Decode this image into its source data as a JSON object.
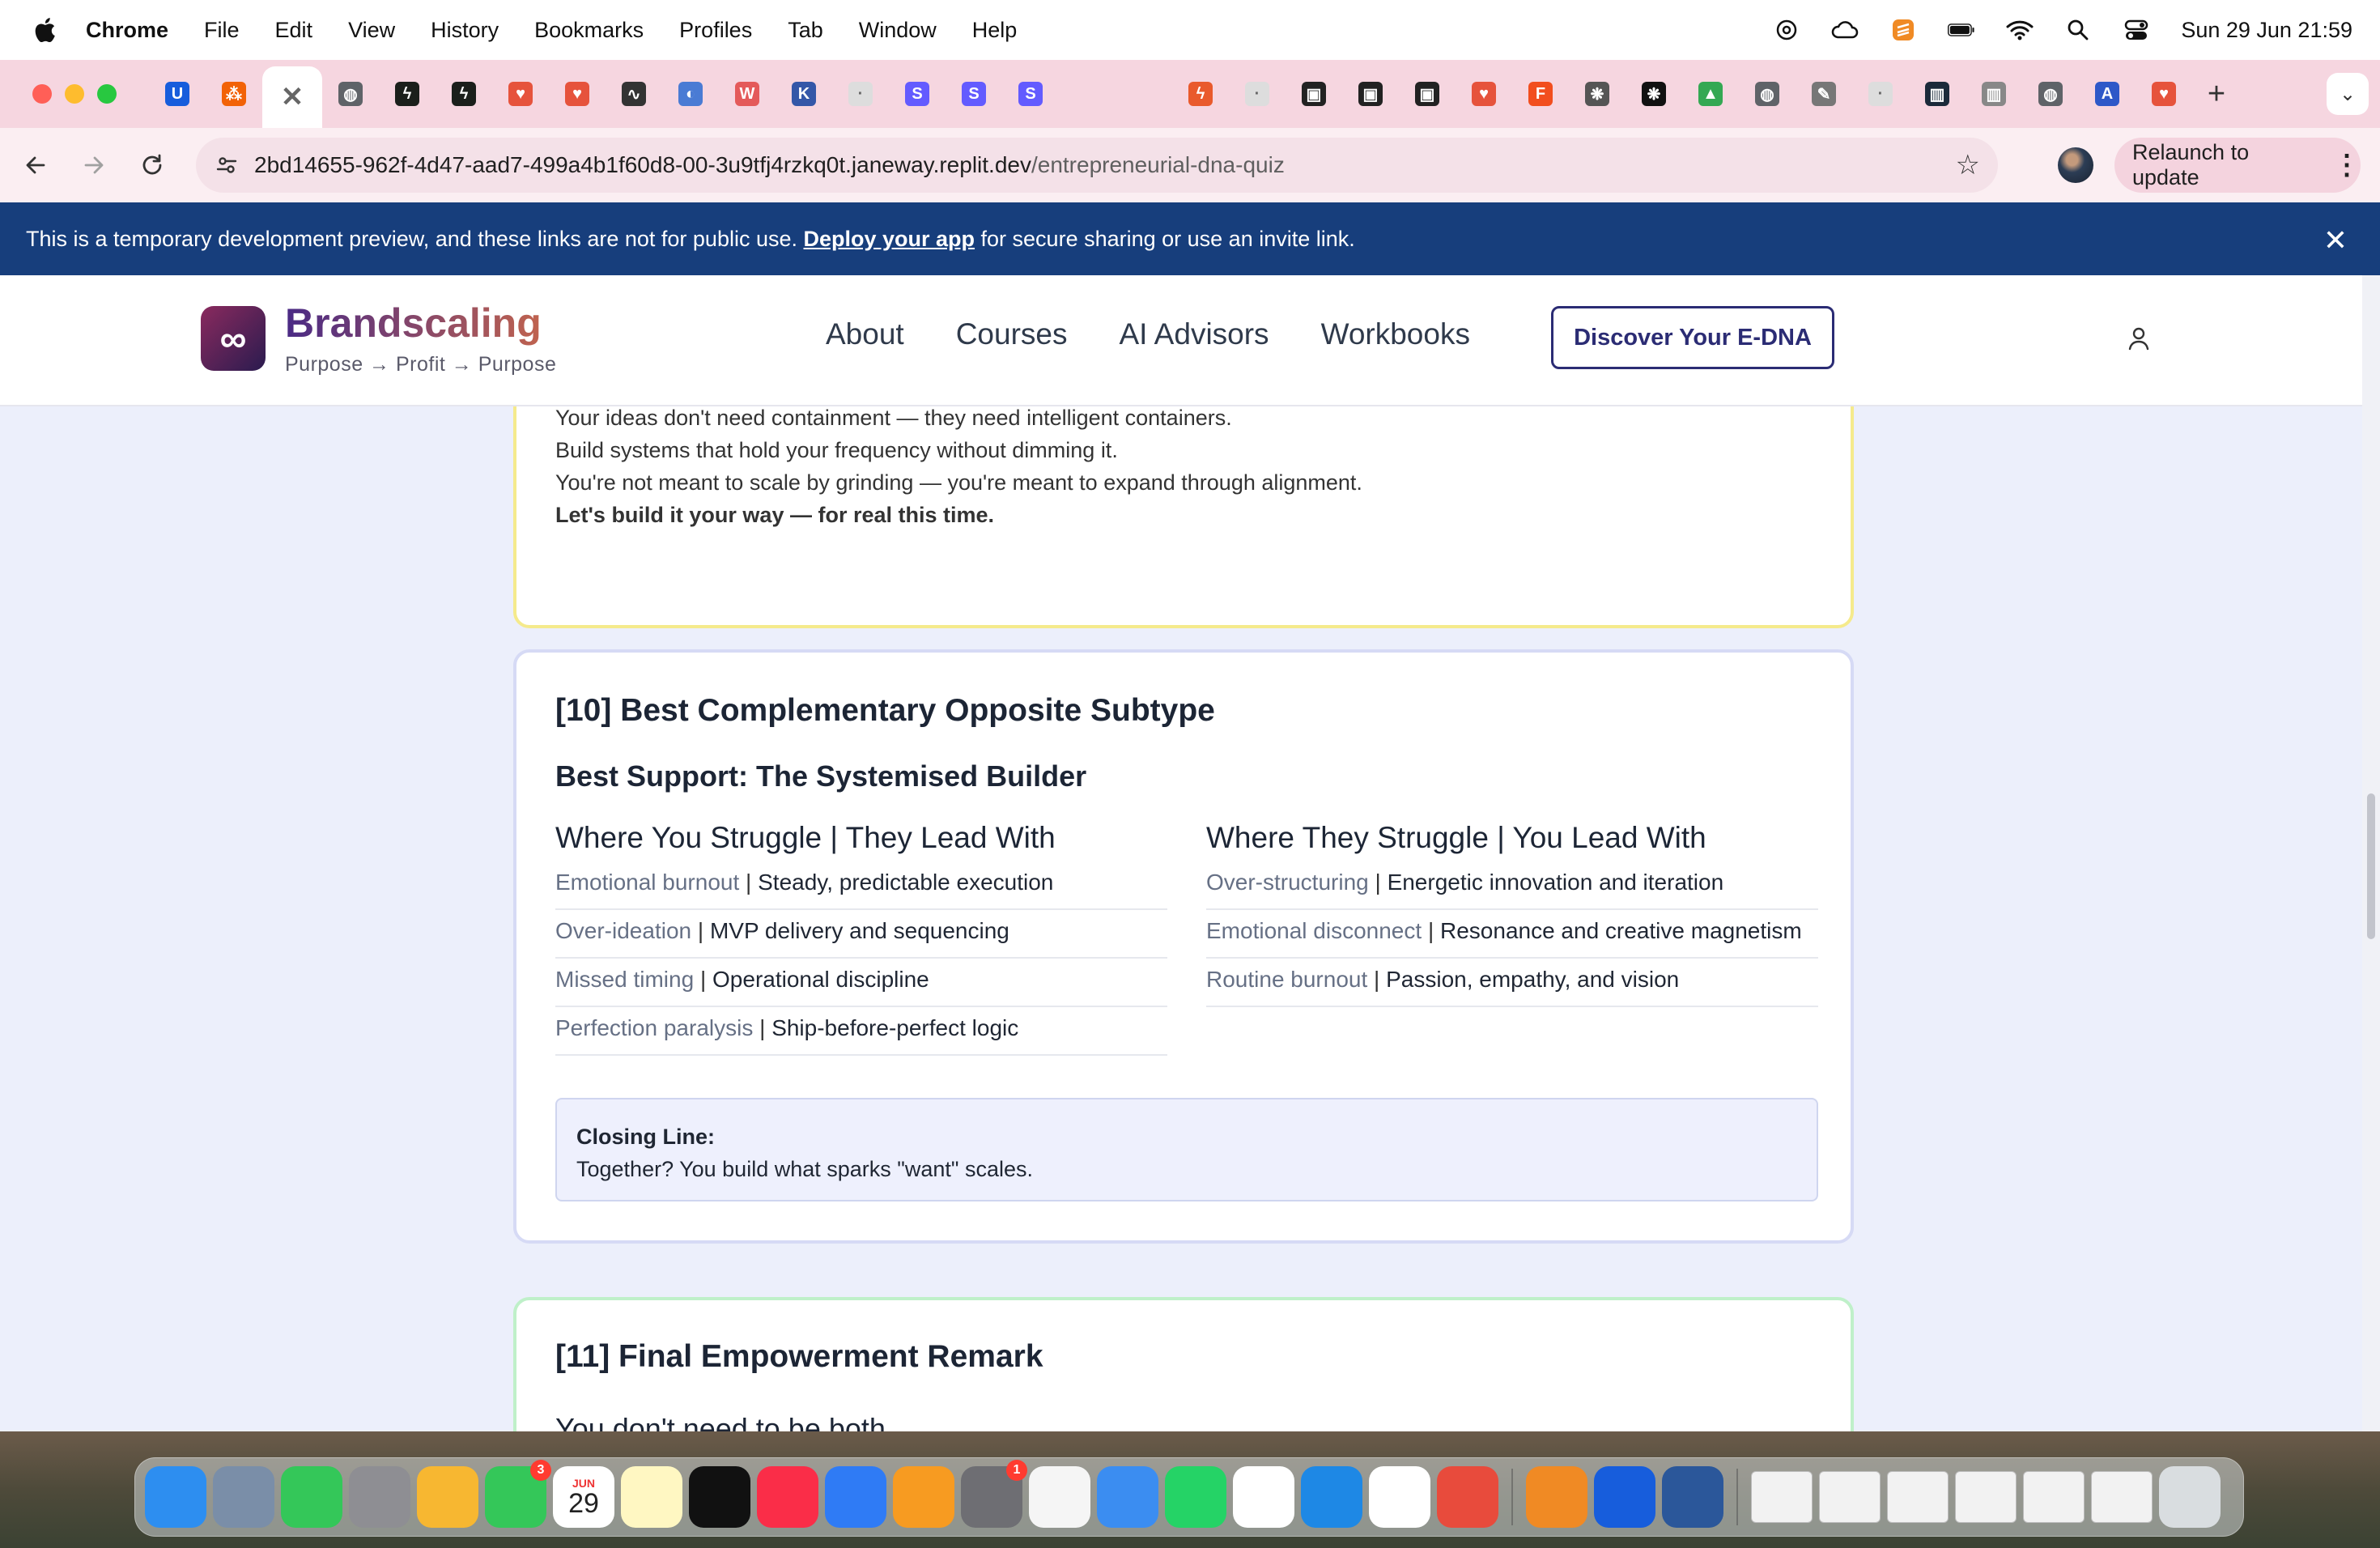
{
  "menubar": {
    "app_name": "Chrome",
    "menus": [
      "File",
      "Edit",
      "View",
      "History",
      "Bookmarks",
      "Profiles",
      "Tab",
      "Window",
      "Help"
    ],
    "clock": "Sun 29 Jun  21:59"
  },
  "browser": {
    "url_host": "2bd14655-962f-4d47-aad7-499a4b1f60d8-00-3u9tfj4rzkq0t.janeway.replit.dev",
    "url_path": "/entrepreneurial-dna-quiz",
    "relaunch_label": "Relaunch to update",
    "tabs": [
      {
        "icon": "bitwarden-icon",
        "color": "#175ddc",
        "glyph": "U"
      },
      {
        "icon": "replit-icon",
        "color": "#f26207",
        "glyph": "⁂"
      },
      {
        "icon": "close-icon",
        "color": "#ffffff",
        "glyph": "✕",
        "active": true
      },
      {
        "icon": "globe-icon",
        "color": "#5f6368",
        "glyph": "◍"
      },
      {
        "icon": "bolt-icon",
        "color": "#1b1f1b",
        "glyph": "ϟ"
      },
      {
        "icon": "bolt-icon",
        "color": "#1b1f1b",
        "glyph": "ϟ"
      },
      {
        "icon": "claude-heart-icon",
        "color": "#e6533c",
        "glyph": "♥"
      },
      {
        "icon": "claude-heart-icon",
        "color": "#e6533c",
        "glyph": "♥"
      },
      {
        "icon": "pulse-icon",
        "color": "#333333",
        "glyph": "∿"
      },
      {
        "icon": "gemini-icon",
        "color": "#4a7bd4",
        "glyph": "◐"
      },
      {
        "icon": "wp-icon",
        "color": "#e45a5a",
        "glyph": "W"
      },
      {
        "icon": "k-icon",
        "color": "#3457a8",
        "glyph": "K"
      },
      {
        "icon": "doc-icon",
        "color": "#dddddd",
        "glyph": "·"
      },
      {
        "icon": "stripe-icon",
        "color": "#635bff",
        "glyph": "S"
      },
      {
        "icon": "stripe-icon",
        "color": "#635bff",
        "glyph": "S"
      },
      {
        "icon": "stripe-icon",
        "color": "#635bff",
        "glyph": "S"
      },
      {
        "icon": "blank-icon",
        "color": "#f6d6e0",
        "glyph": ""
      },
      {
        "icon": "blank-icon",
        "color": "#f6d6e0",
        "glyph": ""
      },
      {
        "icon": "spark-icon",
        "color": "#e95a2c",
        "glyph": "ϟ"
      },
      {
        "icon": "doc-icon",
        "color": "#dddddd",
        "glyph": "·"
      },
      {
        "icon": "tv-icon",
        "color": "#222222",
        "glyph": "▣"
      },
      {
        "icon": "tv-icon",
        "color": "#222222",
        "glyph": "▣"
      },
      {
        "icon": "tv-icon",
        "color": "#222222",
        "glyph": "▣"
      },
      {
        "icon": "claude-heart-icon",
        "color": "#e6533c",
        "glyph": "♥"
      },
      {
        "icon": "figma-icon",
        "color": "#f24e1e",
        "glyph": "F"
      },
      {
        "icon": "openai-icon",
        "color": "#555555",
        "glyph": "❋"
      },
      {
        "icon": "openai-icon",
        "color": "#111111",
        "glyph": "❋"
      },
      {
        "icon": "drive-icon",
        "color": "#34a853",
        "glyph": "▲"
      },
      {
        "icon": "globe-icon",
        "color": "#5f6368",
        "glyph": "◍"
      },
      {
        "icon": "edit-icon",
        "color": "#777777",
        "glyph": "✎"
      },
      {
        "icon": "doc-icon",
        "color": "#dddddd",
        "glyph": "·"
      },
      {
        "icon": "chart-icon",
        "color": "#1b2a3a",
        "glyph": "▥"
      },
      {
        "icon": "chart-icon",
        "color": "#888888",
        "glyph": "▥"
      },
      {
        "icon": "globe-icon",
        "color": "#5f6368",
        "glyph": "◍"
      },
      {
        "icon": "a-icon",
        "color": "#2e58c8",
        "glyph": "A"
      },
      {
        "icon": "claude-heart-icon",
        "color": "#e6533c",
        "glyph": "♥"
      }
    ]
  },
  "banner": {
    "before": "This is a temporary development preview, and these links are not for public use. ",
    "link": "Deploy your app",
    "after": " for secure sharing or use an invite link."
  },
  "site": {
    "brand": "Brandscaling",
    "tagline": "Purpose → Profit → Purpose",
    "nav": [
      "About",
      "Courses",
      "AI Advisors",
      "Workbooks"
    ],
    "cta": "Discover Your E-DNA"
  },
  "prev_card": {
    "lines": [
      "Your ideas don't need containment — they need intelligent containers.",
      "Build systems that hold your frequency without dimming it.",
      "You're not meant to scale by grinding — you're meant to expand through alignment."
    ],
    "bold_line": "Let's build it your way — for real this time."
  },
  "section10": {
    "title": "[10] Best Complementary Opposite Subtype",
    "subtitle": "Best Support: The Systemised Builder",
    "left": {
      "heading": "Where You Struggle | They Lead With",
      "rows": [
        {
          "k": "Emotional burnout",
          "v": "Steady, predictable execution"
        },
        {
          "k": "Over-ideation",
          "v": "MVP delivery and sequencing"
        },
        {
          "k": "Missed timing",
          "v": "Operational discipline"
        },
        {
          "k": "Perfection paralysis",
          "v": "Ship-before-perfect logic"
        }
      ]
    },
    "right": {
      "heading": "Where They Struggle | You Lead With",
      "rows": [
        {
          "k": "Over-structuring",
          "v": "Energetic innovation and iteration"
        },
        {
          "k": "Emotional disconnect",
          "v": "Resonance and creative magnetism"
        },
        {
          "k": "Routine burnout",
          "v": "Passion, empathy, and vision"
        }
      ]
    },
    "closing_label": "Closing Line:",
    "closing_text": "Together? You build what sparks \"want\" scales."
  },
  "section11": {
    "title": "[11] Final Empowerment Remark",
    "cut_text": "You don't need to be both."
  },
  "dock": {
    "calendar_month": "JUN",
    "calendar_day": "29",
    "facetime_badge": "3",
    "settings_badge": "1",
    "apps": [
      {
        "icon": "finder-icon",
        "color": "#2d8ef0"
      },
      {
        "icon": "preview-icon",
        "color": "#7a8ea8"
      },
      {
        "icon": "messages-icon",
        "color": "#34c759"
      },
      {
        "icon": "launchpad-icon",
        "color": "#8e8e93"
      },
      {
        "icon": "photos-icon",
        "color": "#f7b731"
      },
      {
        "icon": "facetime-icon",
        "color": "#34c759"
      },
      {
        "icon": "calendar-icon",
        "color": "#ffffff"
      },
      {
        "icon": "notes-icon",
        "color": "#fff7c2"
      },
      {
        "icon": "appletv-icon",
        "color": "#111111"
      },
      {
        "icon": "music-icon",
        "color": "#fa2d48"
      },
      {
        "icon": "keynote-icon",
        "color": "#2f7bf5"
      },
      {
        "icon": "pages-icon",
        "color": "#f79b21"
      },
      {
        "icon": "system-settings-icon",
        "color": "#6e6e73"
      },
      {
        "icon": "mouse-app-icon",
        "color": "#f5f5f5"
      },
      {
        "icon": "mail-icon",
        "color": "#3b8df1"
      },
      {
        "icon": "whatsapp-icon",
        "color": "#25d366"
      },
      {
        "icon": "chatgpt-icon",
        "color": "#ffffff"
      },
      {
        "icon": "safari-icon",
        "color": "#1e88e5"
      },
      {
        "icon": "chrome-icon",
        "color": "#ffffff"
      },
      {
        "icon": "airmail-icon",
        "color": "#e84b3c"
      },
      {
        "icon": "sublime-icon",
        "color": "#f08a24"
      },
      {
        "icon": "bitwarden-icon",
        "color": "#175ddc"
      },
      {
        "icon": "word-icon",
        "color": "#2b579a"
      }
    ]
  }
}
